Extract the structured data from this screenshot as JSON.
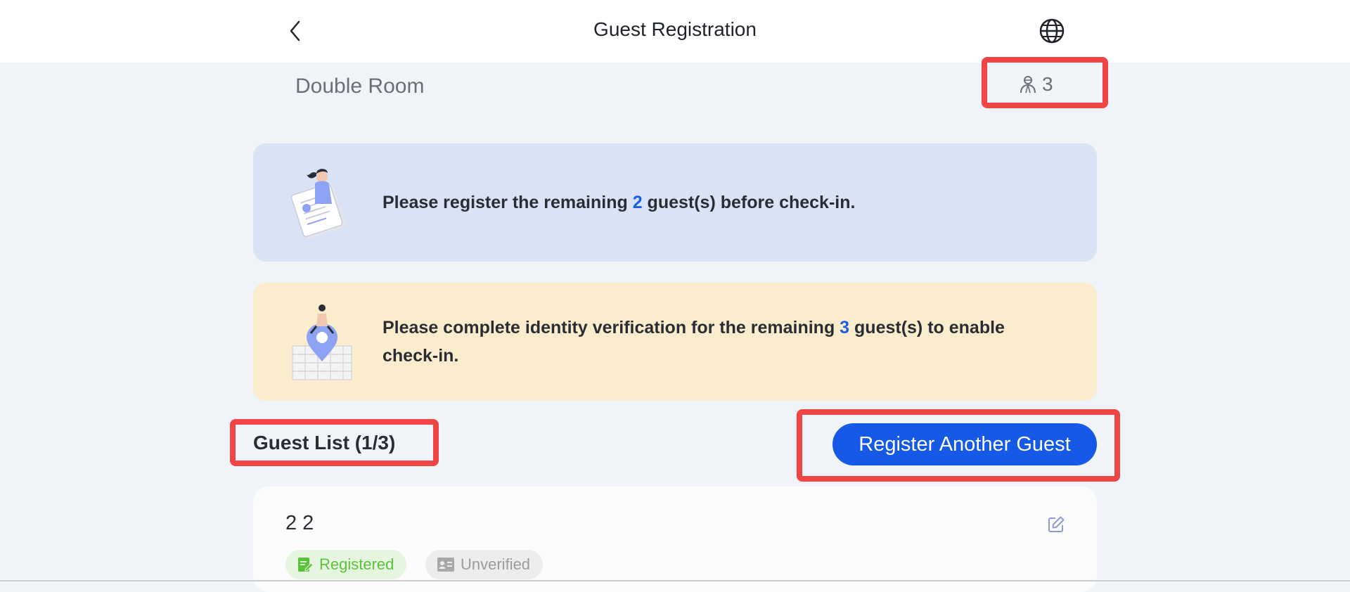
{
  "header": {
    "title": "Guest Registration",
    "back_icon": "chevron-left-icon",
    "language_icon": "globe-icon"
  },
  "room": {
    "name": "Double Room",
    "guest_count": "3",
    "guest_count_icon": "guest-person-icon"
  },
  "notices": {
    "registration": {
      "prefix": "Please register the remaining ",
      "count": "2",
      "suffix": " guest(s) before check-in."
    },
    "verification": {
      "prefix": "Please complete identity verification for the remaining ",
      "count": "3",
      "suffix": " guest(s) to enable check-in."
    }
  },
  "guest_list": {
    "title": "Guest List (1/3)",
    "register_button": "Register Another Guest",
    "guests": [
      {
        "name": "2 2",
        "registration_status": "Registered",
        "verification_status": "Unverified"
      }
    ]
  },
  "colors": {
    "accent": "#1559e6",
    "highlight_box": "#f04545",
    "registered": "#5cc23a",
    "unverified": "#9b9b9b",
    "blue_notice_bg": "#d9e3f5",
    "yellow_notice_bg": "#faeccc"
  }
}
